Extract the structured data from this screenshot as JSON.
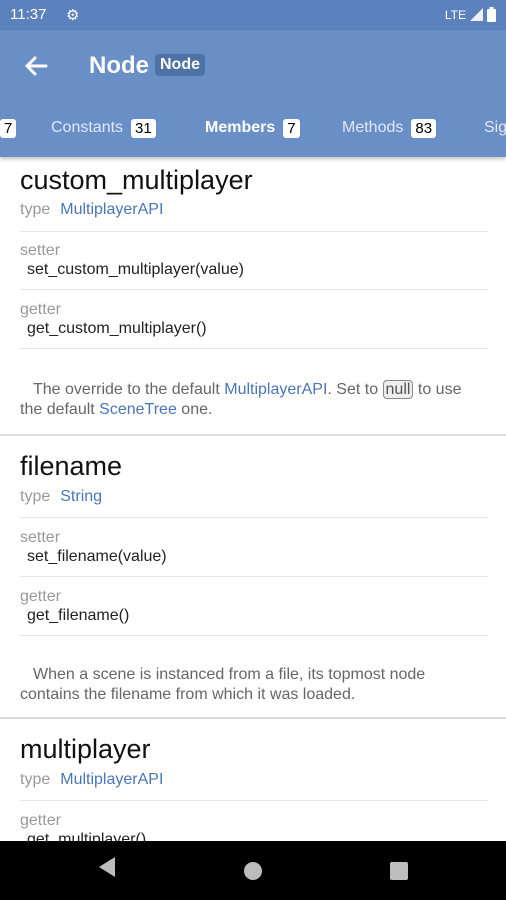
{
  "status": {
    "time": "11:37",
    "network": "LTE"
  },
  "appbar": {
    "title": "Node",
    "chip": "Node"
  },
  "tabs": [
    {
      "label": "",
      "count": "7"
    },
    {
      "label": "Constants",
      "count": "31"
    },
    {
      "label": "Members",
      "count": "7"
    },
    {
      "label": "Methods",
      "count": "83"
    },
    {
      "label": "Sig",
      "count": ""
    }
  ],
  "members": [
    {
      "name": "custom_multiplayer",
      "type_label": "type",
      "type": "MultiplayerAPI",
      "setter_label": "setter",
      "setter": "set_custom_multiplayer(value)",
      "getter_label": "getter",
      "getter": "get_custom_multiplayer()",
      "desc": {
        "p1": "The override to the default ",
        "l1": "MultiplayerAPI",
        "p2": ". Set to ",
        "code": "null",
        "p3": " to use the default ",
        "l2": "SceneTree",
        "p4": " one."
      }
    },
    {
      "name": "filename",
      "type_label": "type",
      "type": "String",
      "setter_label": "setter",
      "setter": "set_filename(value)",
      "getter_label": "getter",
      "getter": "get_filename()",
      "desc": {
        "text": "When a scene is instanced from a file, its topmost node contains the filename from which it was loaded."
      }
    },
    {
      "name": "multiplayer",
      "type_label": "type",
      "type": "MultiplayerAPI",
      "getter_label": "getter",
      "getter": "get_multiplayer()"
    }
  ],
  "icons": {
    "back": "arrow-left-icon",
    "settings": "gear-icon"
  }
}
